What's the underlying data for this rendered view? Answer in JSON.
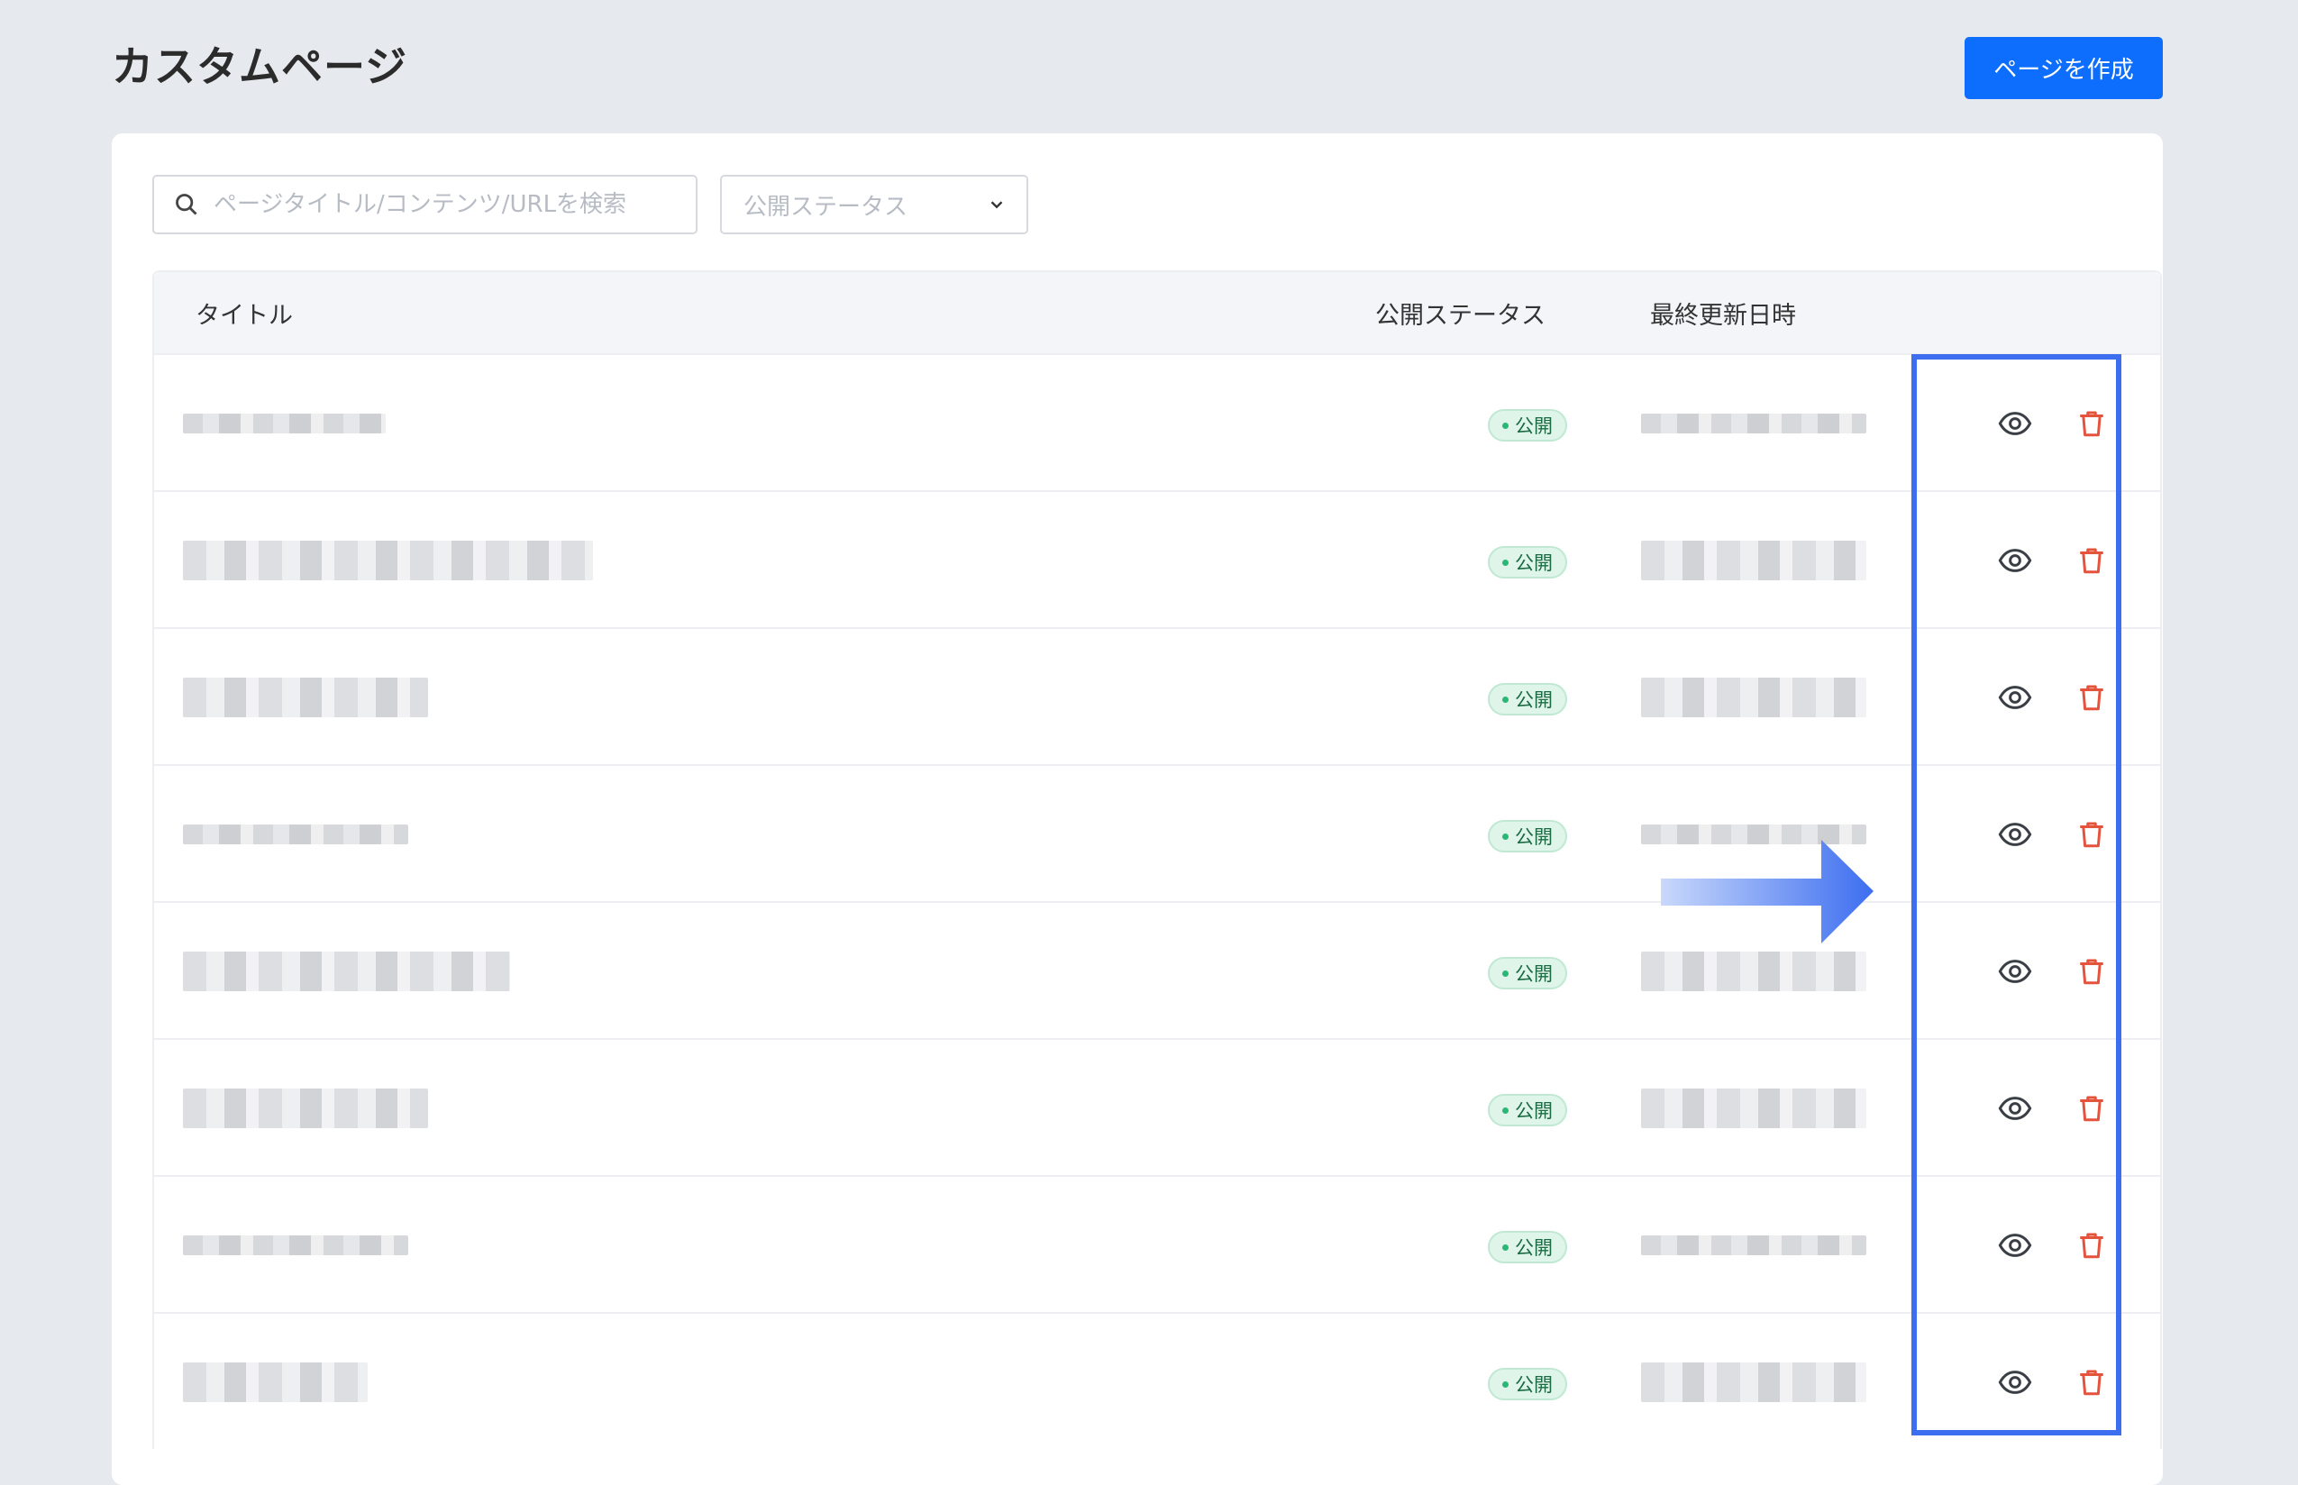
{
  "header": {
    "title": "カスタムページ",
    "create_button": "ページを作成"
  },
  "filters": {
    "search_placeholder": "ページタイトル/コンテンツ/URLを検索",
    "status_placeholder": "公開ステータス"
  },
  "table": {
    "columns": [
      "タイトル",
      "公開ステータス",
      "最終更新日時"
    ],
    "rows": [
      {
        "status": "公開"
      },
      {
        "status": "公開"
      },
      {
        "status": "公開"
      },
      {
        "status": "公開"
      },
      {
        "status": "公開"
      },
      {
        "status": "公開"
      },
      {
        "status": "公開"
      },
      {
        "status": "公開"
      }
    ]
  },
  "colors": {
    "primary": "#0d6efd",
    "highlight": "#3d6ef0",
    "delete": "#e5533d",
    "status_bg": "#dff5ea"
  },
  "icons": [
    "search-icon",
    "chevron-down-icon",
    "eye-icon",
    "trash-icon",
    "arrow-right-icon"
  ]
}
